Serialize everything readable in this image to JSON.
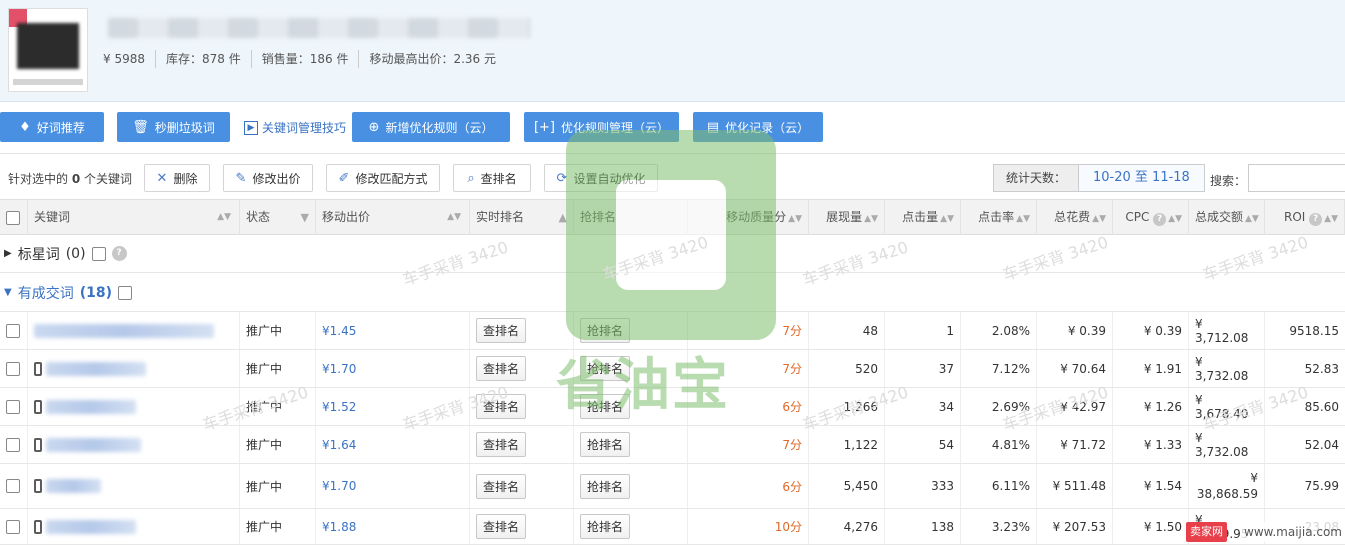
{
  "product": {
    "price": "¥ 5988",
    "stock": "库存：878 件",
    "sales": "销售量：186 件",
    "max_bid": "移动最高出价：2.36 元"
  },
  "toolbar": {
    "good_words": "好词推荐",
    "delete_junk": "秒删垃圾词",
    "tips": "关键词管理技巧",
    "add_rule": "新增优化规则（云）",
    "rule_manage": "优化规则管理（云）",
    "opt_log": "优化记录（云）"
  },
  "actions": {
    "selected_prefix": "针对选中的",
    "selected_count": "0",
    "selected_suffix": "个关键词",
    "delete": "删除",
    "modify_bid": "修改出价",
    "modify_match": "修改匹配方式",
    "check_rank": "查排名",
    "auto_opt": "设置自动优化",
    "stat_days_label": "统计天数：",
    "stat_days_value": "10-20 至 11-18",
    "search_label": "搜索："
  },
  "columns": {
    "keyword": "关键词",
    "status": "状态",
    "mobile_bid": "移动出价",
    "realtime_rank": "实时排名",
    "grab_rank": "抢排名",
    "quality": "移动质量分",
    "impressions": "展现量",
    "clicks": "点击量",
    "ctr": "点击率",
    "cost": "总花费",
    "cpc": "CPC",
    "gmv": "总成交额",
    "roi": "ROI"
  },
  "groups": {
    "starred_label": "标星词",
    "starred_count": "(0)",
    "deal_label": "有成交词",
    "deal_count": "(18)"
  },
  "row_buttons": {
    "check": "查排名",
    "grab": "抢排名"
  },
  "rows": [
    {
      "status": "推广中",
      "bid": "¥1.45",
      "quality": "7分",
      "impr": "48",
      "clicks": "1",
      "ctr": "2.08%",
      "cost": "¥ 0.39",
      "cpc": "¥ 0.39",
      "gmv": "¥ 3,712.08",
      "roi": "9518.15"
    },
    {
      "status": "推广中",
      "bid": "¥1.70",
      "quality": "7分",
      "impr": "520",
      "clicks": "37",
      "ctr": "7.12%",
      "cost": "¥ 70.64",
      "cpc": "¥ 1.91",
      "gmv": "¥ 3,732.08",
      "roi": "52.83"
    },
    {
      "status": "推广中",
      "bid": "¥1.52",
      "quality": "6分",
      "impr": "1,266",
      "clicks": "34",
      "ctr": "2.69%",
      "cost": "¥ 42.97",
      "cpc": "¥ 1.26",
      "gmv": "¥ 3,678.40",
      "roi": "85.60"
    },
    {
      "status": "推广中",
      "bid": "¥1.64",
      "quality": "7分",
      "impr": "1,122",
      "clicks": "54",
      "ctr": "4.81%",
      "cost": "¥ 71.72",
      "cpc": "¥ 1.33",
      "gmv": "¥ 3,732.08",
      "roi": "52.04"
    },
    {
      "status": "推广中",
      "bid": "¥1.70",
      "quality": "6分",
      "impr": "5,450",
      "clicks": "333",
      "ctr": "6.11%",
      "cost": "¥ 511.48",
      "cpc": "¥ 1.54",
      "gmv_line1": "¥",
      "gmv_line2": "38,868.59",
      "roi": "75.99"
    },
    {
      "status": "推广中",
      "bid": "¥1.88",
      "quality": "10分",
      "impr": "4,276",
      "clicks": "138",
      "ctr": "3.23%",
      "cost": "¥ 207.53",
      "cpc": "¥ 1.50",
      "gmv": "¥ 4,789.95",
      "roi": "23.08"
    }
  ],
  "watermark": {
    "brand": "省油宝",
    "tag": "车手采背 3420"
  },
  "corner_badge": {
    "left": "卖家网",
    "right": "www.maijia.com"
  }
}
